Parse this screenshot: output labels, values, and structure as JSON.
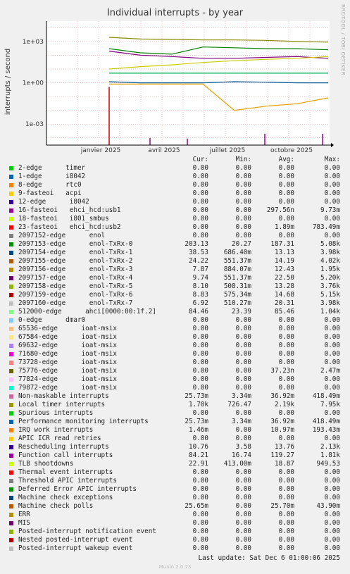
{
  "page": {
    "title": "Individual interrupts - by year",
    "side_label": "RRDTOOL / TOBI OETIKER",
    "last_update": "Last update: Sat Dec  6 01:00:06 2025",
    "munin_version": "Munin 2.0.73"
  },
  "chart_data": {
    "type": "line",
    "title": "Individual interrupts - by year",
    "ylabel": "interrupts / second",
    "yscale": "log",
    "ylim": [
      3e-05,
      30000
    ],
    "y_ticks": [
      "1e+03",
      "1e+00",
      "1e-03"
    ],
    "x_ticks": [
      "janvier 2025",
      "avril 2025",
      "juillet 2025",
      "octobre 2025"
    ],
    "grid": true,
    "series_approx": [
      {
        "name": "TLB shootdowns",
        "color": "#8b8b00",
        "values": [
          null,
          2000,
          1500,
          1400,
          1300,
          1300,
          1200,
          1000,
          900
        ]
      },
      {
        "name": "Rescheduling interrupts",
        "color": "#008000",
        "values": [
          null,
          300,
          150,
          120,
          400,
          350,
          300,
          300,
          250
        ]
      },
      {
        "name": "Performance monitoring interrupts",
        "color": "#00b050",
        "values": [
          null,
          5,
          5,
          5,
          5,
          5,
          5,
          5,
          5
        ]
      },
      {
        "name": "Function call interrupts",
        "color": "#800080",
        "values": [
          null,
          200,
          100,
          80,
          60,
          60,
          70,
          80,
          60
        ]
      },
      {
        "name": "enol1-TxRx-3",
        "color": "#e6a000",
        "values": [
          null,
          0.8,
          0.8,
          0.8,
          0.8,
          0.01,
          0.02,
          0.03,
          0.08
        ]
      },
      {
        "name": "Local timer interrupts",
        "color": "#cccc00",
        "values": [
          null,
          10,
          15,
          20,
          30,
          40,
          50,
          60,
          80
        ]
      },
      {
        "name": "enol1-TxRx-1",
        "color": "#005a99",
        "values": [
          null,
          1.2,
          1,
          1,
          1,
          1.2,
          1.1,
          1,
          1
        ]
      }
    ]
  },
  "legend": {
    "headers": {
      "cur": "Cur:",
      "min": "Min:",
      "avg": "Avg:",
      "max": "Max:"
    },
    "rows": [
      {
        "label": "2-edge      timer",
        "color": "#00cc00",
        "cur": "0.00",
        "min": "0.00",
        "avg": "0.00",
        "max": "0.00"
      },
      {
        "label": "1-edge      i8042",
        "color": "#0066b3",
        "cur": "0.00",
        "min": "0.00",
        "avg": "0.00",
        "max": "0.00"
      },
      {
        "label": "8-edge      rtc0",
        "color": "#ff8000",
        "cur": "0.00",
        "min": "0.00",
        "avg": "0.00",
        "max": "0.00"
      },
      {
        "label": "9-fasteoi   acpi",
        "color": "#ffcc00",
        "cur": "0.00",
        "min": "0.00",
        "avg": "0.00",
        "max": "0.00"
      },
      {
        "label": "12-edge      i8042",
        "color": "#330099",
        "cur": "0.00",
        "min": "0.00",
        "avg": "0.00",
        "max": "0.00"
      },
      {
        "label": "16-fasteoi   ehci_hcd:usb1",
        "color": "#990099",
        "cur": "0.00",
        "min": "0.00",
        "avg": "297.56n",
        "max": "9.73m"
      },
      {
        "label": "18-fasteoi   i801_smbus",
        "color": "#ccff00",
        "cur": "0.00",
        "min": "0.00",
        "avg": "0.00",
        "max": "0.00"
      },
      {
        "label": "23-fasteoi   ehci_hcd:usb2",
        "color": "#ff0000",
        "cur": "0.00",
        "min": "0.00",
        "avg": "1.89m",
        "max": "783.49m"
      },
      {
        "label": "2097152-edge      enol",
        "color": "#808080",
        "cur": "0.00",
        "min": "0.00",
        "avg": "0.00",
        "max": "0.00"
      },
      {
        "label": "2097153-edge      enol-TxRx-0",
        "color": "#008f00",
        "cur": "203.13",
        "min": "20.27",
        "avg": "187.31",
        "max": "5.08k"
      },
      {
        "label": "2097154-edge      enol-TxRx-1",
        "color": "#00487d",
        "cur": "38.53",
        "min": "686.40m",
        "avg": "13.13",
        "max": "3.98k"
      },
      {
        "label": "2097155-edge      enol-TxRx-2",
        "color": "#b35a00",
        "cur": "24.22",
        "min": "551.37m",
        "avg": "14.19",
        "max": "4.02k"
      },
      {
        "label": "2097156-edge      enol-TxRx-3",
        "color": "#b38f00",
        "cur": "7.87",
        "min": "884.07m",
        "avg": "12.43",
        "max": "1.95k"
      },
      {
        "label": "2097157-edge      enol-TxRx-4",
        "color": "#6b006b",
        "cur": "9.74",
        "min": "551.37m",
        "avg": "22.50",
        "max": "5.20k"
      },
      {
        "label": "2097158-edge      enol-TxRx-5",
        "color": "#8fb300",
        "cur": "8.10",
        "min": "508.31m",
        "avg": "13.28",
        "max": "3.76k"
      },
      {
        "label": "2097159-edge      enol-TxRx-6",
        "color": "#b30000",
        "cur": "8.83",
        "min": "575.34m",
        "avg": "14.68",
        "max": "5.15k"
      },
      {
        "label": "2097160-edge      enol-TxRx-7",
        "color": "#bebebe",
        "cur": "6.92",
        "min": "510.27m",
        "avg": "20.31",
        "max": "3.98k"
      },
      {
        "label": "512000-edge      ahci[0000:00:1f.2]",
        "color": "#80ff80",
        "cur": "84.46",
        "min": "23.39",
        "avg": "85.46",
        "max": "1.04k"
      },
      {
        "label": "0-edge      dmar0",
        "color": "#80c9ff",
        "cur": "0.00",
        "min": "0.00",
        "avg": "0.00",
        "max": "0.00"
      },
      {
        "label": "65536-edge      ioat-msix",
        "color": "#ffc080",
        "cur": "0.00",
        "min": "0.00",
        "avg": "0.00",
        "max": "0.00"
      },
      {
        "label": "67584-edge      ioat-msix",
        "color": "#ffe680",
        "cur": "0.00",
        "min": "0.00",
        "avg": "0.00",
        "max": "0.00"
      },
      {
        "label": "69632-edge      ioat-msix",
        "color": "#aa80ff",
        "cur": "0.00",
        "min": "0.00",
        "avg": "0.00",
        "max": "0.00"
      },
      {
        "label": "71680-edge      ioat-msix",
        "color": "#ee00cc",
        "cur": "0.00",
        "min": "0.00",
        "avg": "0.00",
        "max": "0.00"
      },
      {
        "label": "73728-edge      ioat-msix",
        "color": "#ff8080",
        "cur": "0.00",
        "min": "0.00",
        "avg": "0.00",
        "max": "0.00"
      },
      {
        "label": "75776-edge      ioat-msix",
        "color": "#666600",
        "cur": "0.00",
        "min": "0.00",
        "avg": "37.23n",
        "max": "2.47m"
      },
      {
        "label": "77824-edge      ioat-msix",
        "color": "#ffbfff",
        "cur": "0.00",
        "min": "0.00",
        "avg": "0.00",
        "max": "0.00"
      },
      {
        "label": "79872-edge      ioat-msix",
        "color": "#00ffcc",
        "cur": "0.00",
        "min": "0.00",
        "avg": "0.00",
        "max": "0.00"
      },
      {
        "label": "Non-maskable interrupts",
        "color": "#cc6699",
        "cur": "25.73m",
        "min": "3.34m",
        "avg": "36.92m",
        "max": "418.49m"
      },
      {
        "label": "Local timer interrupts",
        "color": "#999900",
        "cur": "1.70k",
        "min": "726.47",
        "avg": "2.19k",
        "max": "7.95k"
      },
      {
        "label": "Spurious interrupts",
        "color": "#00cc00",
        "cur": "0.00",
        "min": "0.00",
        "avg": "0.00",
        "max": "0.00"
      },
      {
        "label": "Performance monitoring interrupts",
        "color": "#0066b3",
        "cur": "25.73m",
        "min": "3.34m",
        "avg": "36.92m",
        "max": "418.49m"
      },
      {
        "label": "IRQ work interrupts",
        "color": "#ff8000",
        "cur": "1.46m",
        "min": "0.00",
        "avg": "10.97m",
        "max": "193.43m"
      },
      {
        "label": "APIC ICR read retries",
        "color": "#ffcc00",
        "cur": "0.00",
        "min": "0.00",
        "avg": "0.00",
        "max": "0.00"
      },
      {
        "label": "Rescheduling interrupts",
        "color": "#330099",
        "cur": "10.76",
        "min": "3.58",
        "avg": "13.76",
        "max": "2.13k"
      },
      {
        "label": "Function call interrupts",
        "color": "#990099",
        "cur": "84.21",
        "min": "16.74",
        "avg": "119.27",
        "max": "1.81k"
      },
      {
        "label": "TLB shootdowns",
        "color": "#ccff00",
        "cur": "22.91",
        "min": "413.00m",
        "avg": "18.87",
        "max": "949.53"
      },
      {
        "label": "Thermal event interrupts",
        "color": "#ff0000",
        "cur": "0.00",
        "min": "0.00",
        "avg": "0.00",
        "max": "0.00"
      },
      {
        "label": "Threshold APIC interrupts",
        "color": "#808080",
        "cur": "0.00",
        "min": "0.00",
        "avg": "0.00",
        "max": "0.00"
      },
      {
        "label": "Deferred Error APIC interrupts",
        "color": "#008f00",
        "cur": "0.00",
        "min": "0.00",
        "avg": "0.00",
        "max": "0.00"
      },
      {
        "label": "Machine check exceptions",
        "color": "#00487d",
        "cur": "0.00",
        "min": "0.00",
        "avg": "0.00",
        "max": "0.00"
      },
      {
        "label": "Machine check polls",
        "color": "#b35a00",
        "cur": "25.65m",
        "min": "0.00",
        "avg": "25.70m",
        "max": "43.90m"
      },
      {
        "label": "ERR",
        "color": "#b38f00",
        "cur": "0.00",
        "min": "0.00",
        "avg": "0.00",
        "max": "0.00"
      },
      {
        "label": "MIS",
        "color": "#6b006b",
        "cur": "0.00",
        "min": "0.00",
        "avg": "0.00",
        "max": "0.00"
      },
      {
        "label": "Posted-interrupt notification event",
        "color": "#8fb300",
        "cur": "0.00",
        "min": "0.00",
        "avg": "0.00",
        "max": "0.00"
      },
      {
        "label": "Nested posted-interrupt event",
        "color": "#b30000",
        "cur": "0.00",
        "min": "0.00",
        "avg": "0.00",
        "max": "0.00"
      },
      {
        "label": "Posted-interrupt wakeup event",
        "color": "#bebebe",
        "cur": "0.00",
        "min": "0.00",
        "avg": "0.00",
        "max": "0.00"
      }
    ]
  }
}
